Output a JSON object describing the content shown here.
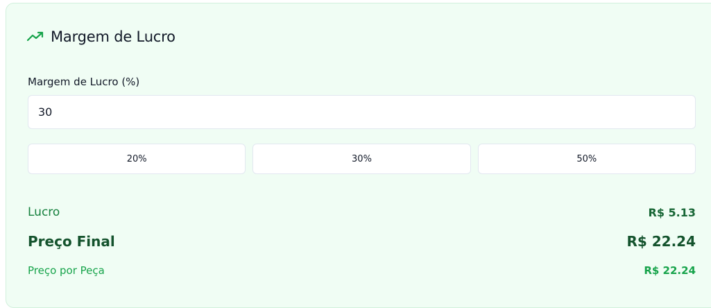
{
  "card": {
    "title": "Margem de Lucro",
    "icon": "trending-up-icon",
    "accent_color": "#16a34a"
  },
  "margin_field": {
    "label": "Margem de Lucro (%)",
    "value": "30"
  },
  "presets": [
    {
      "label": "20%"
    },
    {
      "label": "30%"
    },
    {
      "label": "50%"
    }
  ],
  "results": {
    "lucro_label": "Lucro",
    "lucro_value": "R$ 5.13",
    "preco_final_label": "Preço Final",
    "preco_final_value": "R$ 22.24",
    "preco_peca_label": "Preço por Peça",
    "preco_peca_value": "R$ 22.24"
  }
}
